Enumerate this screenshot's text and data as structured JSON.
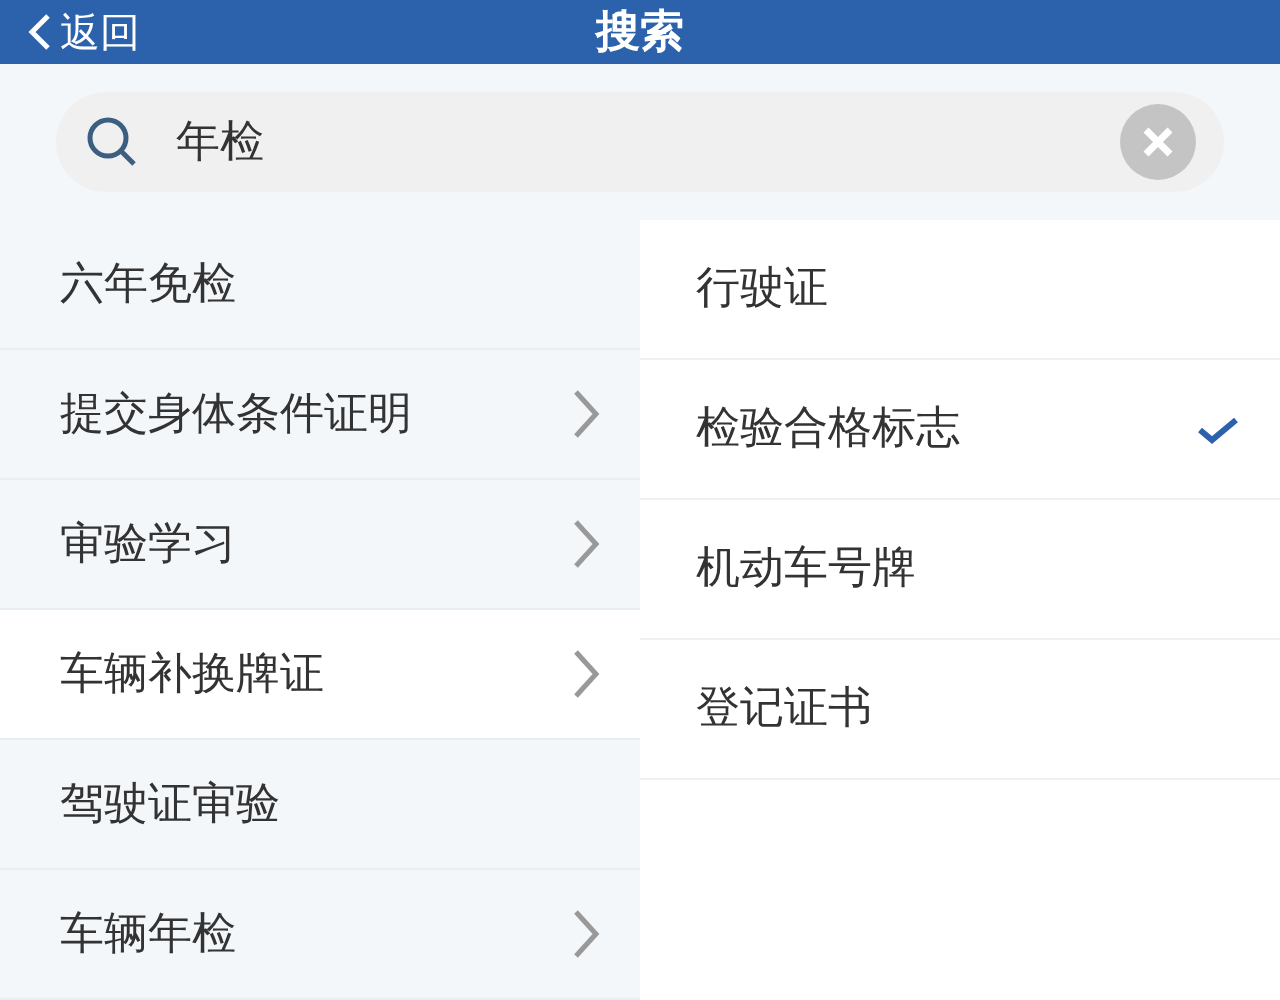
{
  "header": {
    "back": "返回",
    "title": "搜索"
  },
  "search": {
    "value": "年检"
  },
  "categories": [
    {
      "label": "六年免检",
      "has_children": false,
      "selected": false
    },
    {
      "label": "提交身体条件证明",
      "has_children": true,
      "selected": false
    },
    {
      "label": "审验学习",
      "has_children": true,
      "selected": false
    },
    {
      "label": "车辆补换牌证",
      "has_children": true,
      "selected": true
    },
    {
      "label": "驾驶证审验",
      "has_children": false,
      "selected": false
    },
    {
      "label": "车辆年检",
      "has_children": true,
      "selected": false
    }
  ],
  "options": [
    {
      "label": "行驶证",
      "selected": false
    },
    {
      "label": "检验合格标志",
      "selected": true
    },
    {
      "label": "机动车号牌",
      "selected": false
    },
    {
      "label": "登记证书",
      "selected": false
    }
  ]
}
